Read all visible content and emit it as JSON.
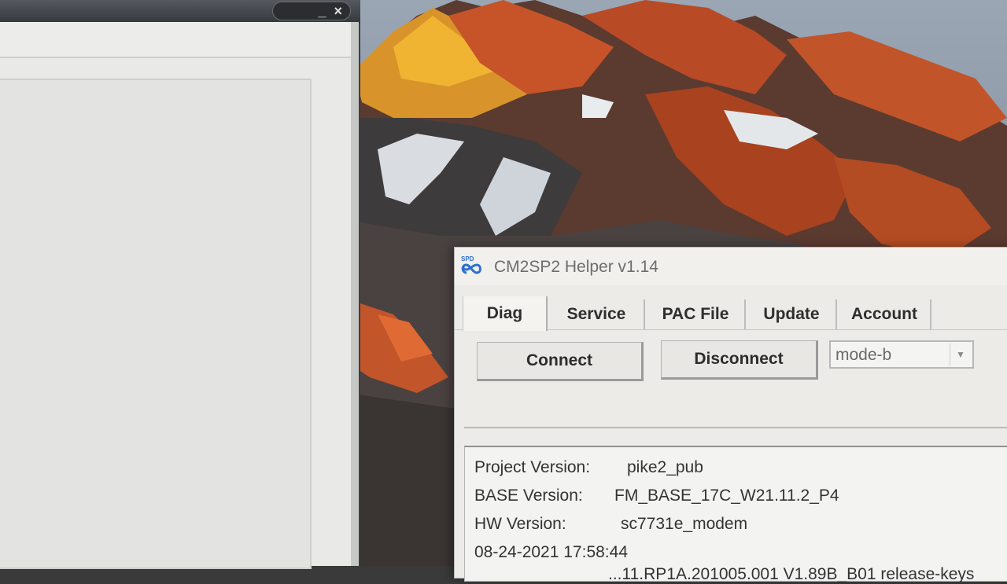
{
  "left_window": {
    "controls": {
      "minimize": "_",
      "close": "×"
    }
  },
  "helper": {
    "icon_text": "SPD",
    "title": "CM2SP2 Helper v1.14",
    "tabs": [
      {
        "label": "Diag",
        "active": true
      },
      {
        "label": "Service",
        "active": false
      },
      {
        "label": "PAC File",
        "active": false
      },
      {
        "label": "Update",
        "active": false
      },
      {
        "label": "Account",
        "active": false
      }
    ],
    "buttons": {
      "connect": "Connect",
      "disconnect": "Disconnect"
    },
    "mode_select": {
      "value": "mode-b",
      "arrow": "▼"
    },
    "info": [
      {
        "label": "Project Version:",
        "value": "pike2_pub"
      },
      {
        "label": "BASE  Version:",
        "value": "FM_BASE_17C_W21.11.2_P4"
      },
      {
        "label": "HW Version:",
        "value": "sc7731e_modem"
      },
      {
        "label": "08-24-2021 17:58:44",
        "value": ""
      },
      {
        "label": "",
        "value": "...11.RP1A.201005.001 V1.89B_B01 release-keys"
      }
    ]
  },
  "colors": {
    "window_bg": "#ecebe8",
    "tab_text": "#2e2e2e",
    "title_text": "#6d6d6d",
    "icon_blue": "#2f6fd0"
  }
}
